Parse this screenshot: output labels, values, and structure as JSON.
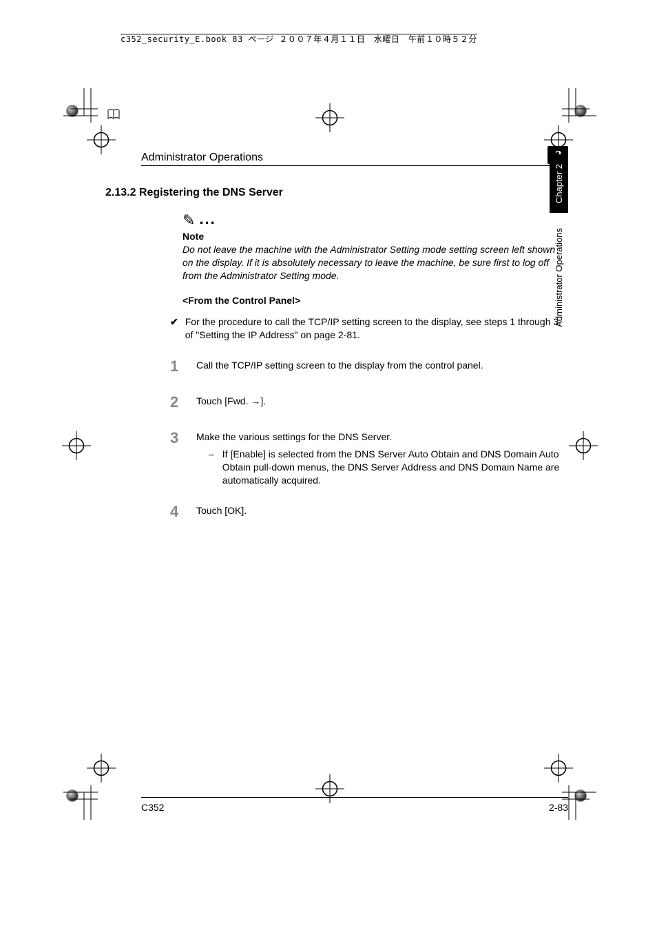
{
  "print_header": "c352_security_E.book  83 ページ  ２００７年４月１１日　水曜日　午前１０時５２分",
  "header": {
    "title": "Administrator Operations",
    "chapter_number": "2"
  },
  "section_heading": "2.13.2  Registering the DNS Server",
  "note": {
    "label": "Note",
    "text": "Do not leave the machine with the Administrator Setting mode setting screen left shown on the display. If it is absolutely necessary to leave the machine, be sure first to log off from the Administrator Setting mode."
  },
  "sub_heading": "<From the Control Panel>",
  "bullet": "For the procedure to call the TCP/IP setting screen to the display, see steps 1 through 3 of \"Setting the IP Address\" on page 2-81.",
  "steps": [
    {
      "num": "1",
      "text": "Call the TCP/IP setting screen to the display from the control panel."
    },
    {
      "num": "2",
      "text": "Touch [Fwd. →]."
    },
    {
      "num": "3",
      "text": "Make the various settings for the DNS Server.",
      "sub": "If [Enable] is selected from the DNS Server Auto Obtain and DNS Domain Auto Obtain pull-down menus, the DNS Server Address and DNS Domain Name are automatically acquired."
    },
    {
      "num": "4",
      "text": "Touch [OK]."
    }
  ],
  "side_tabs": {
    "chapter": "Chapter 2",
    "label": "Administrator Operations"
  },
  "footer": {
    "model": "C352",
    "page": "2-83"
  }
}
